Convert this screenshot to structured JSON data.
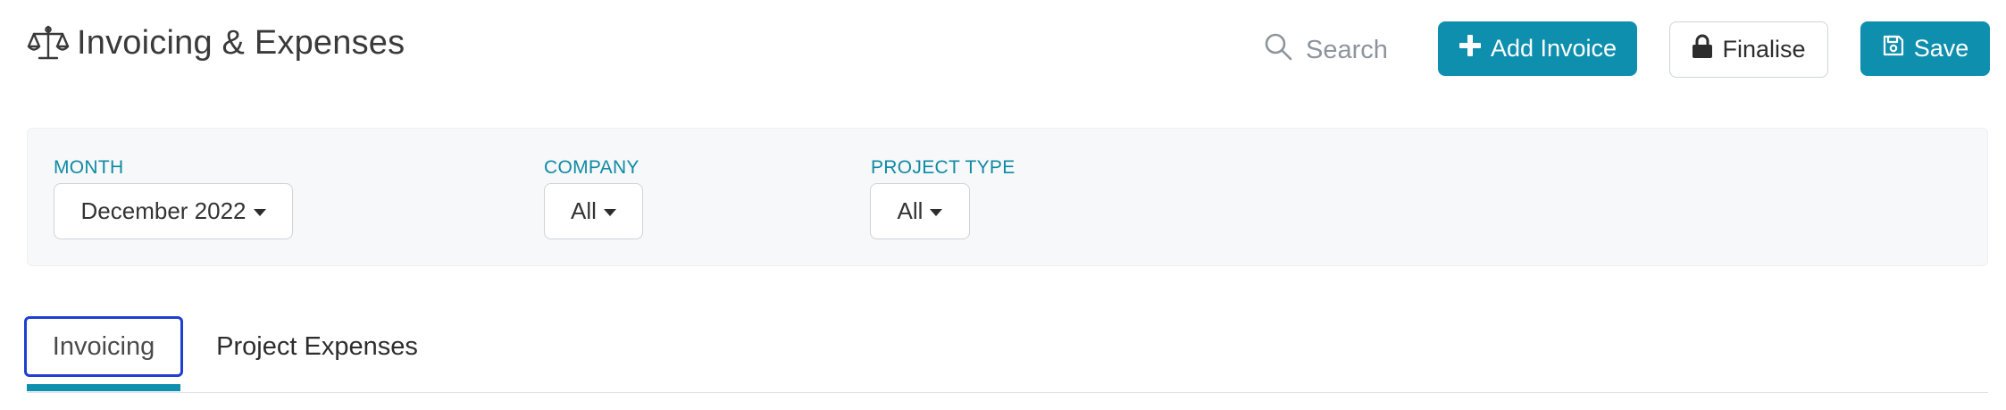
{
  "header": {
    "title": "Invoicing & Expenses",
    "title_icon": "scales-icon",
    "search": {
      "label": "Search",
      "icon": "search-icon"
    },
    "add_invoice": {
      "label": "Add Invoice",
      "icon": "plus-icon"
    },
    "finalise": {
      "label": "Finalise",
      "icon": "lock-icon"
    },
    "save": {
      "label": "Save",
      "icon": "save-icon"
    }
  },
  "filters": {
    "month": {
      "label": "MONTH",
      "value": "December 2022"
    },
    "company": {
      "label": "COMPANY",
      "value": "All"
    },
    "project_type": {
      "label": "PROJECT TYPE",
      "value": "All"
    }
  },
  "tabs": [
    {
      "label": "Invoicing",
      "active": true
    },
    {
      "label": "Project Expenses",
      "active": false
    }
  ],
  "colors": {
    "accent": "#0f8fae",
    "label": "#118aa5",
    "focus_outline": "#1f3fd1",
    "panel_bg": "#f6f8f9"
  }
}
